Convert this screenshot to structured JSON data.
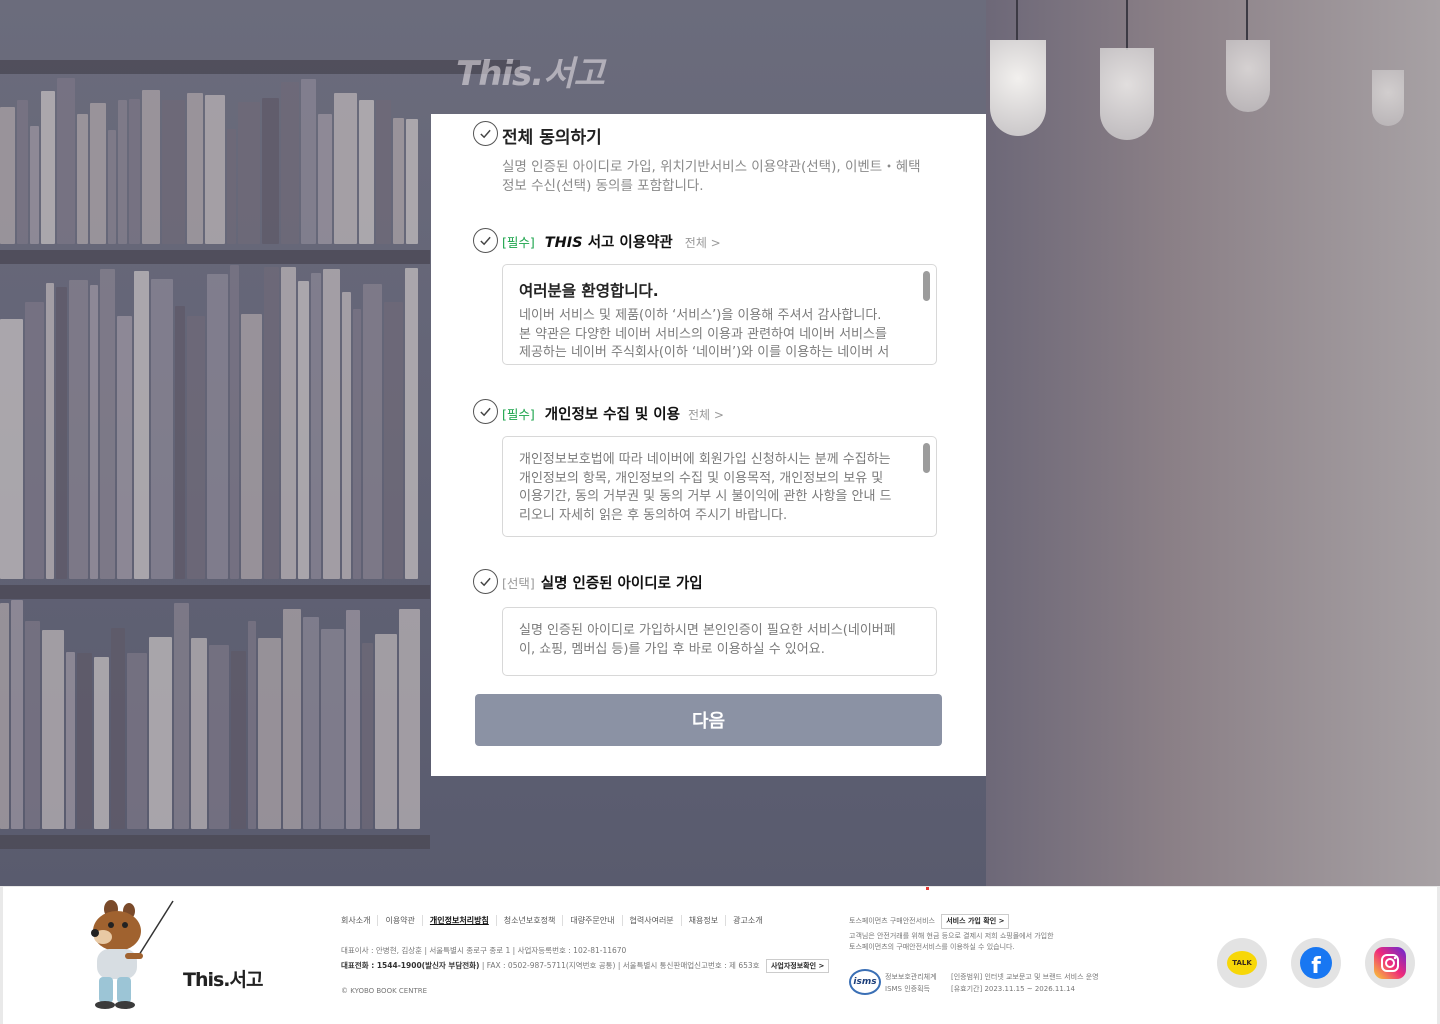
{
  "brand": {
    "logo_top": "This.서고",
    "logo_footer": "This.서고"
  },
  "colors": {
    "required_tag": "#1aa34a",
    "next_button": "#8b92a4",
    "panel_bg": "#ffffff"
  },
  "agreement": {
    "all": {
      "title": "전체 동의하기",
      "description": "실명 인증된 아이디로 가입, 위치기반서비스 이용약관(선택), 이벤트・혜택 정보 수신(선택) 동의를 포함합니다."
    },
    "items": [
      {
        "tag": "[필수]",
        "title_italic": "THIS",
        "title": " 서고 이용약관",
        "view_all": "전체 >",
        "box_heading": "여러분을 환영합니다.",
        "box_text": "네이버 서비스 및 제품(이하 ‘서비스’)을 이용해 주셔서 감사합니다. 본 약관은 다양한 네이버 서비스의 이용과 관련하여 네이버 서비스를 제공하는 네이버 주식회사(이하 ‘네이버’)와 이를 이용하는 네이버 서비스 회원(이하 ‘회원’) 또는 비회원과의 관계를 설명하며, 아울러"
      },
      {
        "tag": "[필수]",
        "title": "개인정보 수집 및 이용",
        "view_all": "전체 >",
        "box_text": "개인정보보호법에 따라 네이버에 회원가입 신청하시는 분께 수집하는 개인정보의 항목, 개인정보의 수집 및 이용목적, 개인정보의 보유 및 이용기간, 동의 거부권 및 동의 거부 시 불이익에 관한 사항을 안내 드리오니 자세히 읽은 후 동의하여 주시기 바랍니다."
      },
      {
        "tag": "[선택]",
        "title": "실명 인증된 아이디로 가입",
        "box_text": "실명 인증된 아이디로 가입하시면 본인인증이 필요한 서비스(네이버페이, 쇼핑, 멤버십 등)를 가입 후 바로 이용하실 수 있어요."
      }
    ],
    "next_label": "다음"
  },
  "footer": {
    "links": [
      "회사소개",
      "이용약관",
      "개인정보처리방침",
      "청소년보호정책",
      "대량주문안내",
      "협력사여러분",
      "채용정보",
      "광고소개"
    ],
    "info_line1": "대표이사 : 안병현, 김상훈 | 서울특별시 종로구 종로 1 | 사업자등록번호 : 102-81-11670",
    "info_line2_bold": "대표전화 : 1544-1900(발신자 부담전화)",
    "info_line2": " | FAX : 0502-987-5711(지역번호 공통) | 서울특별시 통신판매업신고번호 : 제 653호",
    "biz_info_button": "사업자정보확인 >",
    "copyright": "© KYOBO BOOK CENTRE",
    "toss_title": "토스페이먼츠 구매안전서비스",
    "toss_button": "서비스 가입 확인 >",
    "toss_desc1": "고객님은 안전거래를 위해 현금 등으로 결제시 저희 쇼핑몰에서 가입한",
    "toss_desc2": "토스페이먼츠의 구매안전서비스를 이용하실 수 있습니다.",
    "isms_logo": "isms",
    "isms_label1": "정보보호관리체계",
    "isms_label2": "ISMS 인증획득",
    "isms_scope": "[인증범위] 인터넷 교보문고 및 브랜드 서비스 운영",
    "isms_period": "[유효기간] 2023.11.15 ~ 2026.11.14",
    "sns": [
      {
        "name": "kakao-talk",
        "label": "TALK"
      },
      {
        "name": "facebook",
        "label": "f"
      },
      {
        "name": "instagram",
        "label": ""
      }
    ]
  }
}
